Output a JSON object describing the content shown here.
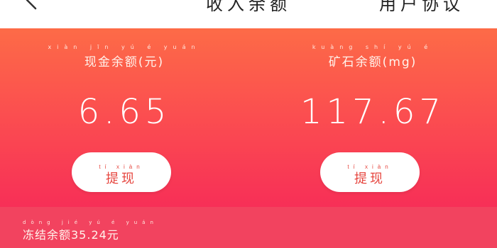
{
  "header": {
    "title": "收入余额",
    "agreement_label": "用户协议",
    "back_icon": "chevron-left-icon"
  },
  "cash": {
    "label_pinyin": "xiàn jīn yú é yuán",
    "label": "现金余额(元)",
    "amount": "6.65",
    "button_pinyin": "tí xiàn",
    "button_label": "提现"
  },
  "mineral": {
    "label_pinyin": "kuàng shí yú é",
    "label": "矿石余额(mg)",
    "amount": "117.67",
    "button_pinyin": "tí xiàn",
    "button_label": "提现"
  },
  "frozen": {
    "label_pinyin": "dòng jié yú é yuán",
    "label": "冻结余额35.24元"
  },
  "colors": {
    "gradient_top": "#fd6b47",
    "gradient_bottom": "#f72f57",
    "footer_bg": "#f2435f",
    "button_text": "#e6463f"
  }
}
